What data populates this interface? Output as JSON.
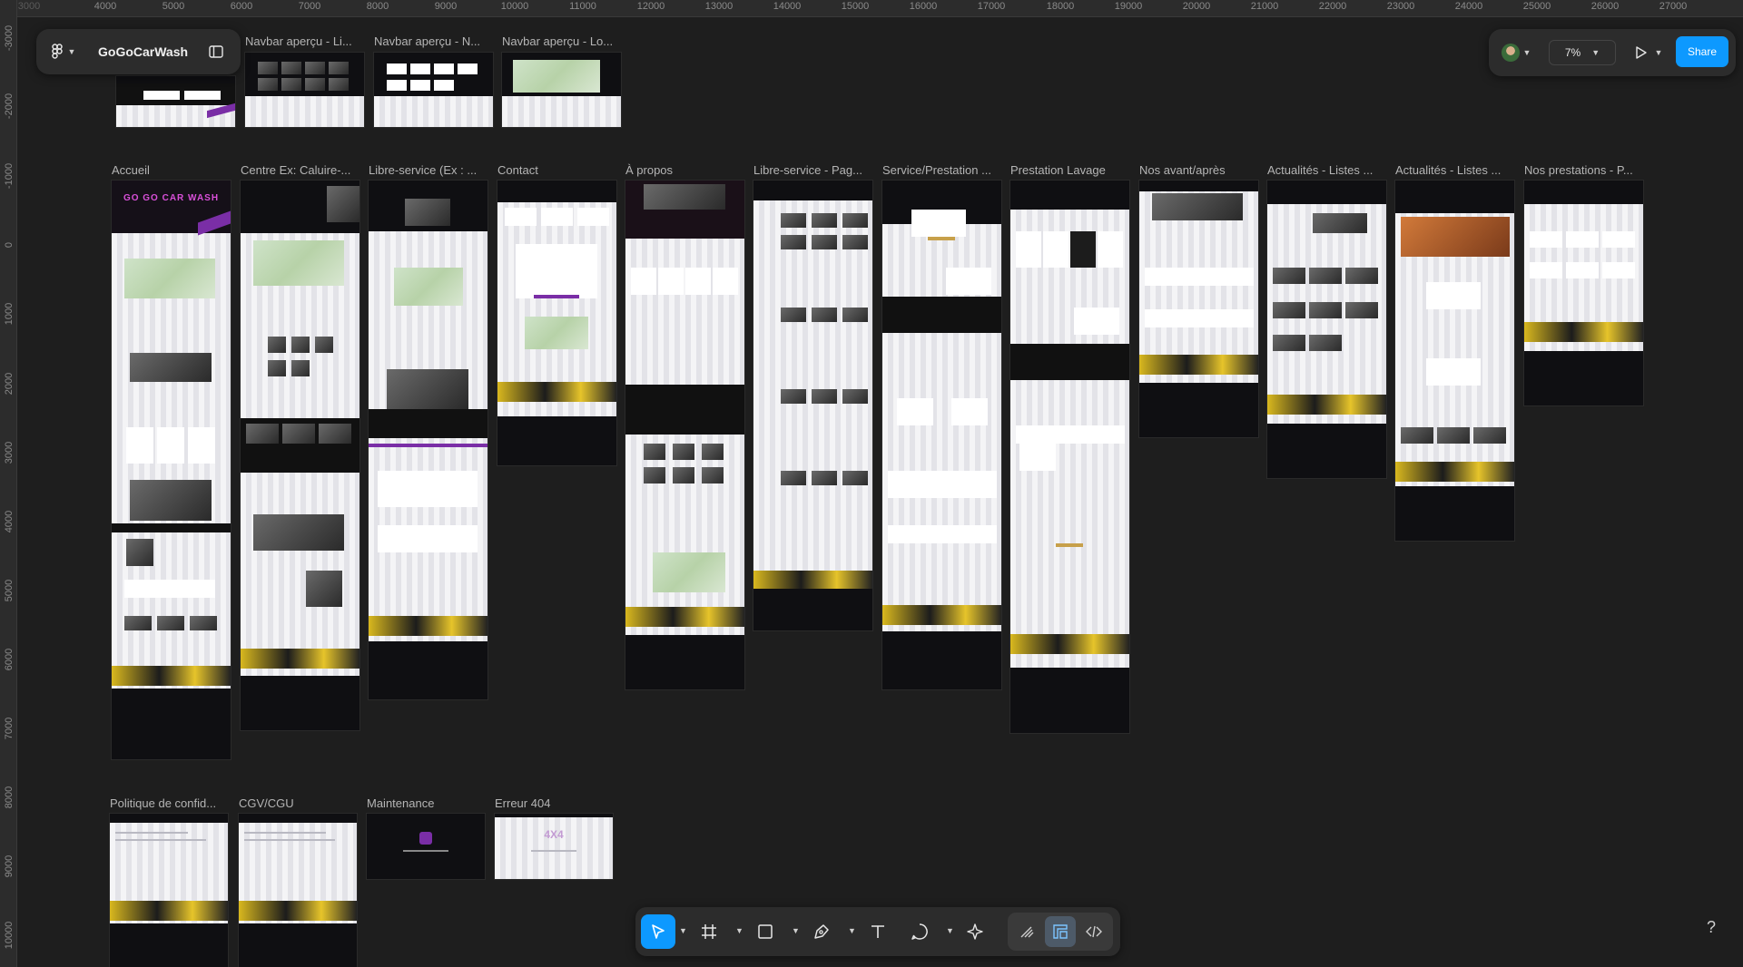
{
  "app": {
    "file_name": "GoGoCarWash",
    "zoom": "7%",
    "share_label": "Share"
  },
  "rulers": {
    "top": [
      "3000",
      "4000",
      "5000",
      "6000",
      "7000",
      "8000",
      "9000",
      "10000",
      "11000",
      "12000",
      "13000",
      "14000",
      "15000",
      "16000",
      "17000",
      "18000",
      "19000",
      "20000",
      "21000",
      "22000",
      "23000",
      "24000",
      "25000",
      "26000",
      "27000"
    ],
    "left": [
      "-3000",
      "-2000",
      "-1000",
      "0",
      "1000",
      "2000",
      "3000",
      "4000",
      "5000",
      "6000",
      "7000",
      "8000",
      "9000",
      "10000"
    ]
  },
  "frames": {
    "nav1": "Navbar aperçu - Li...",
    "nav2": "Navbar aperçu - N...",
    "nav3": "Navbar aperçu - Lo...",
    "accueil": "Accueil",
    "centre": "Centre Ex: Caluire-...",
    "libre": "Libre-service (Ex : ...",
    "contact": "Contact",
    "apropos": "À propos",
    "libre_page": "Libre-service - Pag...",
    "service": "Service/Prestation ...",
    "lavage": "Prestation Lavage",
    "avant": "Nos avant/après",
    "actu1": "Actualités - Listes ...",
    "actu2": "Actualités - Listes ...",
    "presta": "Nos prestations - P...",
    "politique": "Politique de confid...",
    "cgv": "CGV/CGU",
    "maintenance": "Maintenance",
    "erreur": "Erreur 404"
  },
  "thumb_text": {
    "hero": "GO GO CAR WASH",
    "error_code": "4X4"
  },
  "colors": {
    "accent": "#0d99ff",
    "brand_purple": "#7a2ea6",
    "canvas": "#1e1e1e"
  },
  "toolbar_icons": [
    "move-icon",
    "frame-icon",
    "rectangle-icon",
    "pen-icon",
    "text-icon",
    "comment-icon",
    "actions-icon",
    "draw-mode-icon",
    "design-mode-icon",
    "dev-mode-icon"
  ]
}
